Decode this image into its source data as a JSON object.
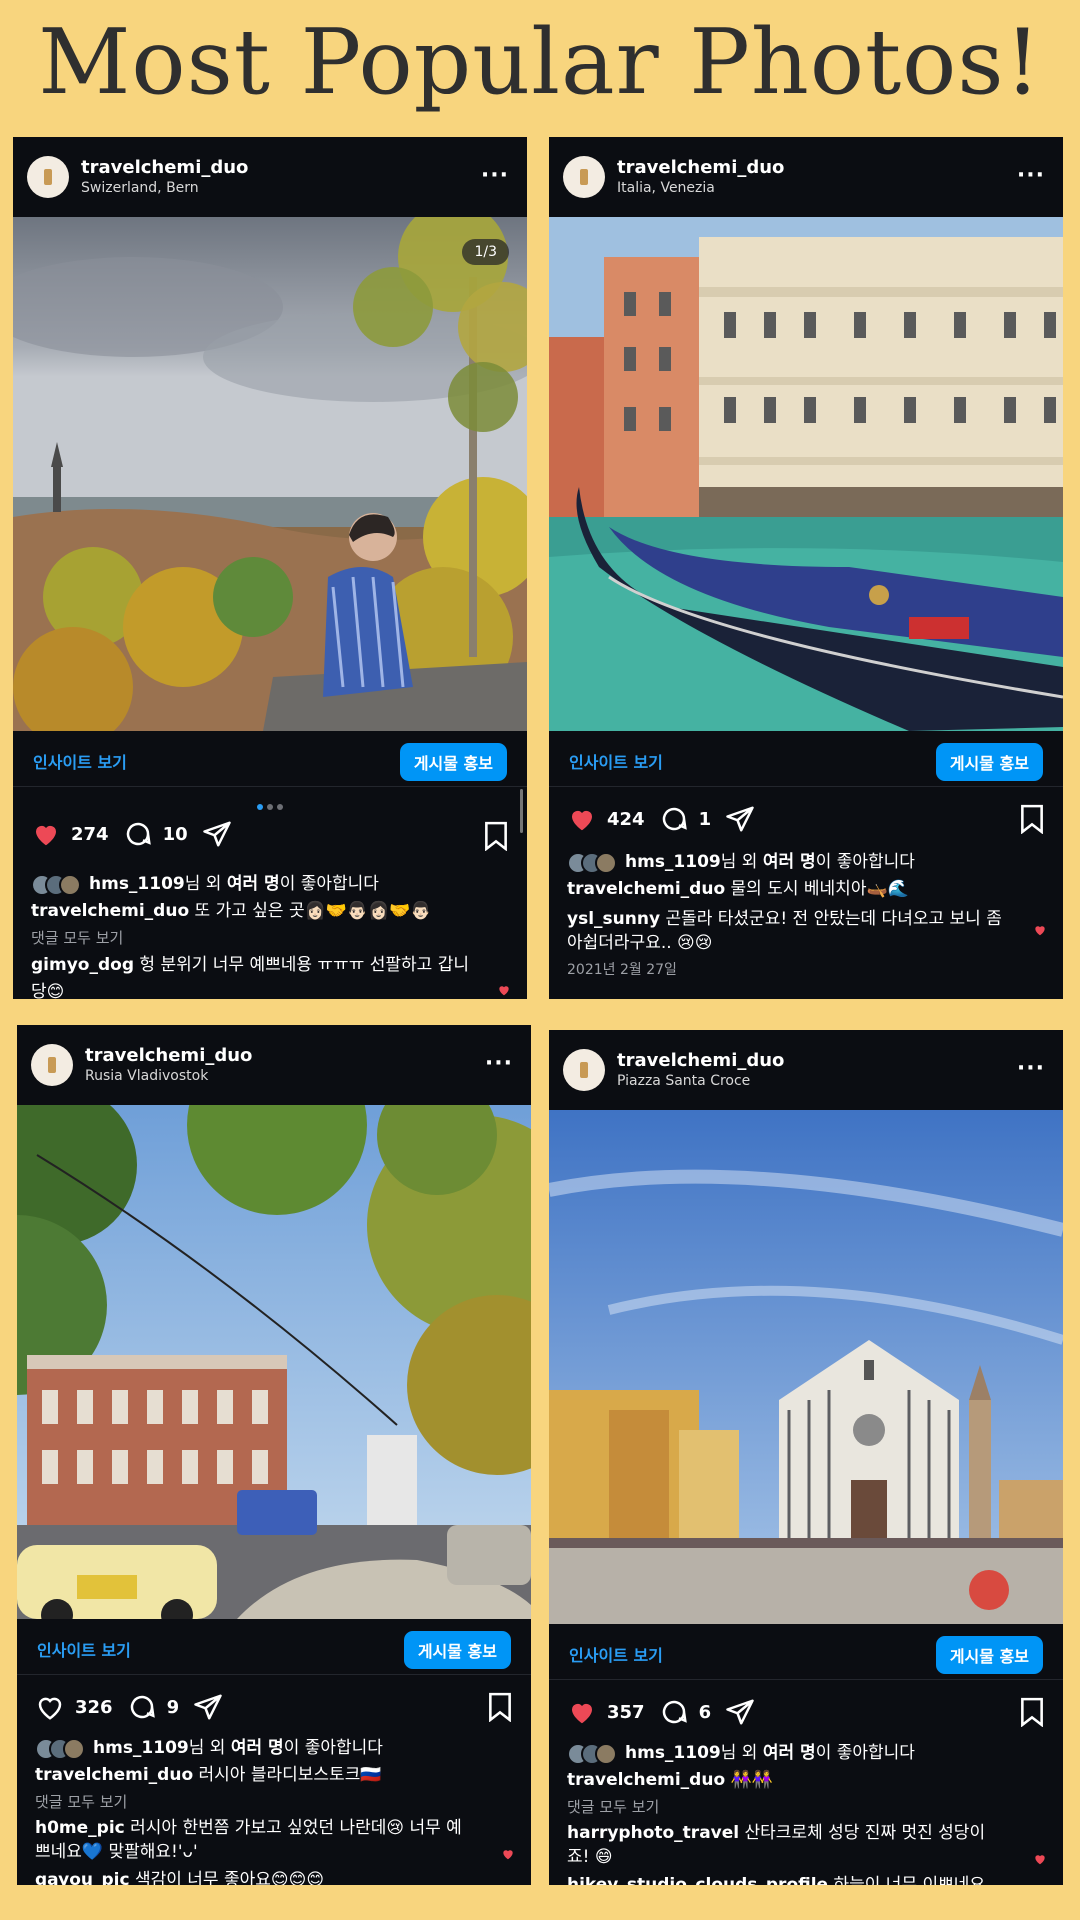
{
  "page": {
    "title": "Most Popular Photos!"
  },
  "common": {
    "insight_label": "인사이트 보기",
    "promote_label": "게시물 홍보",
    "view_all": "댓글 모두 보기",
    "more": "···"
  },
  "posts": [
    {
      "username": "travelchemi_duo",
      "location": "Swizerland, Bern",
      "counter": "1/3",
      "likes": "274",
      "comments": "10",
      "liked": true,
      "likers": {
        "name": "hms_1109",
        "suffix1": "님 외 ",
        "bold": "여러 명",
        "suffix2": "이 좋아합니다"
      },
      "caption": {
        "user": "travelchemi_duo",
        "text": " 또 가고 싶은 곳👩🏻‍🤝‍👨🏻👩🏻‍🤝‍👨🏻"
      },
      "comment": {
        "user": "gimyo_dog",
        "text": " 헝 분위기 너무 예쁘네용 ㅠㅠㅠ 선팔하고 갑니당😊"
      }
    },
    {
      "username": "travelchemi_duo",
      "location": "Italia, Venezia",
      "likes": "424",
      "comments": "1",
      "liked": true,
      "likers": {
        "name": "hms_1109",
        "suffix1": "님 외 ",
        "bold": "여러 명",
        "suffix2": "이 좋아합니다"
      },
      "caption": {
        "user": "travelchemi_duo",
        "text": " 물의 도시 베네치아🛶🌊"
      },
      "comment": {
        "user": "ysl_sunny",
        "text": " 곤돌라 타셨군요! 전 안탔는데 다녀오고 보니 좀 아쉽더라구요.. 😢😢"
      },
      "date": "2021년 2월 27일"
    },
    {
      "username": "travelchemi_duo",
      "location": "Rusia Vladivostok",
      "likes": "326",
      "comments": "9",
      "liked": false,
      "likers": {
        "name": "hms_1109",
        "suffix1": "님 외 ",
        "bold": "여러 명",
        "suffix2": "이 좋아합니다"
      },
      "caption": {
        "user": "travelchemi_duo",
        "text": " 러시아 블라디보스토크🇷🇺"
      },
      "comment": {
        "user": "h0me_pic",
        "text": " 러시아 한번쯤 가보고 싶었던 나란데😢 너무 예쁘네요💙 맞팔해요!'ᴗ'"
      },
      "comment2": {
        "user": "gayou_pic",
        "text": " 색감이 너무 좋아요😊😊😊"
      }
    },
    {
      "username": "travelchemi_duo",
      "location": "Piazza Santa Croce",
      "likes": "357",
      "comments": "6",
      "liked": true,
      "likers": {
        "name": "hms_1109",
        "suffix1": "님 외 ",
        "bold": "여러 명",
        "suffix2": "이 좋아합니다"
      },
      "caption": {
        "user": "travelchemi_duo",
        "text": " 👭👭"
      },
      "comment": {
        "user": "harryphoto_travel",
        "text": " 산타크로체 성당 진짜 멋진 성당이죠! 😄"
      },
      "comment2": {
        "user": "hikey_studio_clouds_profile",
        "text": " 하늘이 너무 이쁘네요 💗 호수"
      }
    }
  ],
  "colors": {
    "background": "#f8d57e",
    "card": "#0b0d12",
    "link": "#2a9df4",
    "button": "#0095f6",
    "heart": "#ed4956"
  }
}
